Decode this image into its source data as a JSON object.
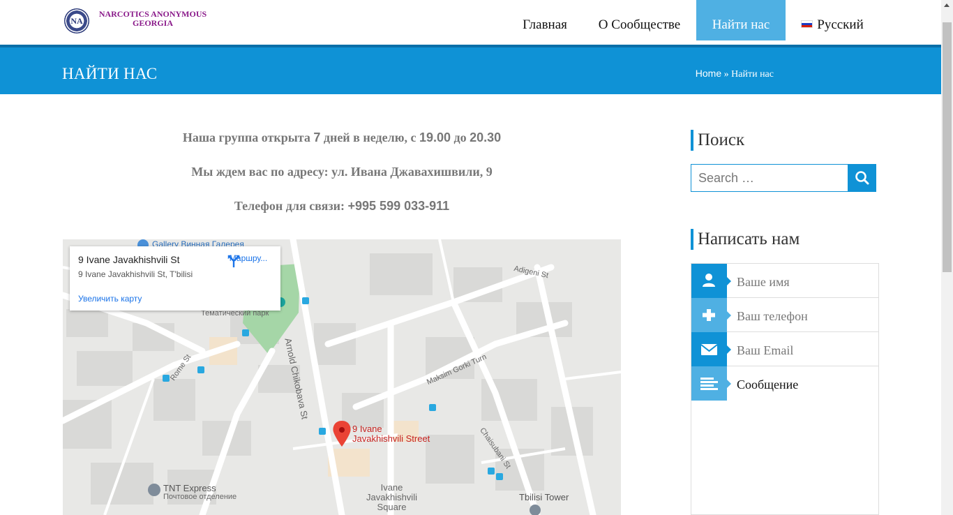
{
  "header": {
    "logo_text_line1": "NARCOTICS ANONYMOUS",
    "logo_text_line2": "GEORGIA",
    "logo_badge": "NA",
    "nav": [
      {
        "label": "Главная"
      },
      {
        "label": "О Сообществе"
      },
      {
        "label": "Найти нас",
        "active": true
      },
      {
        "label": "Русский",
        "icon": "russian-flag-icon"
      }
    ]
  },
  "title_bar": {
    "title": "НАЙТИ НАС",
    "breadcrumb_home": "Home",
    "breadcrumb_sep": "»",
    "breadcrumb_current": "Найти нас"
  },
  "content": {
    "line1_a": "Наша группа открыта",
    "line1_days": "7",
    "line1_b": "дней в неделю, с",
    "line1_from": "19.00",
    "line1_to_word": "до",
    "line1_to": "20.30",
    "line2": "Мы ждем вас по адресу: ул. Ивана Джавахишвили, 9",
    "line3_a": "Телефон для связи:",
    "line3_phone": "+995 599 033-911"
  },
  "map": {
    "card_title": "9 Ivane Javakhishvili St",
    "card_address": "9 Ivane Javakhishvili St, T'bilisi",
    "card_route": "Маршру...",
    "card_enlarge": "Увеличить карту",
    "pin_label_1": "9 Ivane",
    "pin_label_2": "Javakhishvili Street",
    "labels": {
      "gallery": "Gallery Винная Галерея",
      "park": "Тематический парк",
      "street_arnold": "Arnold Chikobava St",
      "street_maksim": "Maksim Gorki Turn",
      "street_rome": "Rome St",
      "street_adigeni": "Adigeni St",
      "street_chaisubani": "Chaisubani St",
      "tnt": "TNT Express",
      "tnt_sub": "Почтовое отделение",
      "square_1": "Ivane",
      "square_2": "Javakhishvili",
      "square_3": "Square",
      "tower": "Tbilisi Tower"
    },
    "colors": {
      "pin": "#ea4335",
      "park": "#a5d6a7",
      "road": "#ffffff",
      "block": "#d9d9d7"
    }
  },
  "sidebar": {
    "search_title": "Поиск",
    "search_placeholder": "Search …",
    "contact_title": "Написать нам",
    "fields": [
      {
        "label": "Ваше имя",
        "icon": "user-icon"
      },
      {
        "label": "Ваш телефон",
        "icon": "plus-icon"
      },
      {
        "label": "Ваш Email",
        "icon": "envelope-icon"
      },
      {
        "label": "Сообщение",
        "icon": "text-lines-icon"
      }
    ]
  },
  "colors": {
    "accent": "#0f92d6",
    "accent_light": "#4fb0e3",
    "logo_purple": "#8a1a8a"
  }
}
